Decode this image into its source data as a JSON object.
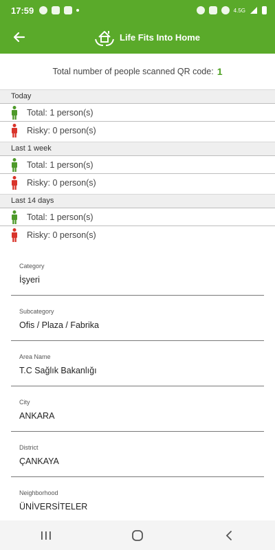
{
  "status_bar": {
    "time": "17:59",
    "network": "4.5G"
  },
  "app_bar": {
    "title": "Life Fits Into Home"
  },
  "summary": {
    "label": "Total number of people scanned QR code:",
    "count": "1"
  },
  "stats": [
    {
      "period": "Today",
      "total": "Total: 1 person(s)",
      "risky": "Risky: 0 person(s)"
    },
    {
      "period": "Last 1 week",
      "total": "Total: 1 person(s)",
      "risky": "Risky: 0 person(s)"
    },
    {
      "period": "Last 14 days",
      "total": "Total: 1 person(s)",
      "risky": "Risky: 0 person(s)"
    }
  ],
  "details": [
    {
      "label": "Category",
      "value": "İşyeri"
    },
    {
      "label": "Subcategory",
      "value": "Ofis / Plaza / Fabrika"
    },
    {
      "label": "Area Name",
      "value": "T.C Sağlık Bakanlığı"
    },
    {
      "label": "City",
      "value": "ANKARA"
    },
    {
      "label": "District",
      "value": "ÇANKAYA"
    },
    {
      "label": "Neighborhood",
      "value": "ÜNİVERSİTELER"
    }
  ],
  "colors": {
    "brand_green": "#5aaa2a",
    "count_green": "#4fa125",
    "total_person": "#4e9a2a",
    "risky_person": "#d9342b"
  },
  "icons": {
    "back": "arrow-left-icon",
    "logo": "home-hands-icon",
    "total": "person-green-icon",
    "risky": "person-red-icon",
    "nav_recents": "recents-icon",
    "nav_home": "home-circle-icon",
    "nav_back": "chevron-left-icon"
  }
}
